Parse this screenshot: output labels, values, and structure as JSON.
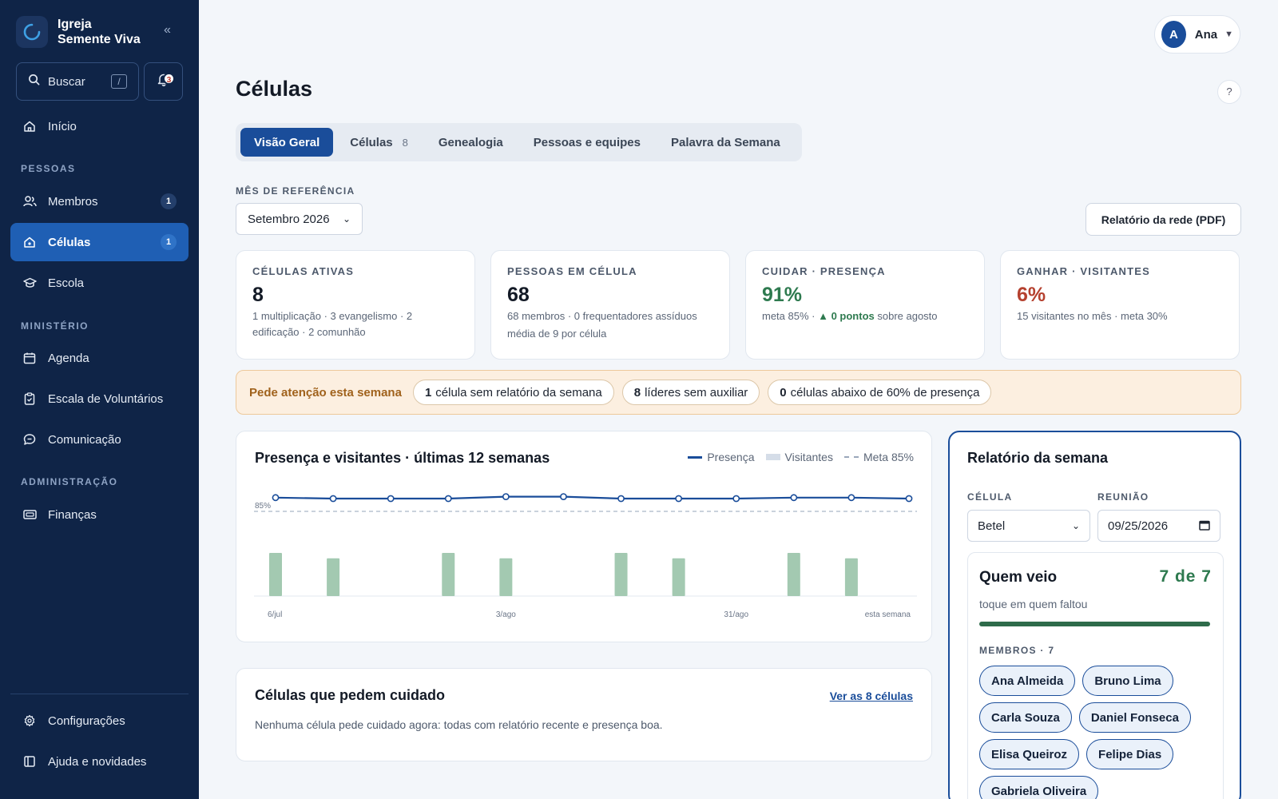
{
  "brand": {
    "line1": "Igreja",
    "line2": "Semente Viva"
  },
  "sidebar": {
    "search_label": "Buscar",
    "search_shortcut": "/",
    "notifications_count": "3",
    "home": "Início",
    "sections": {
      "people": "PESSOAS",
      "ministry": "MINISTÉRIO",
      "admin": "ADMINISTRAÇÃO"
    },
    "items": {
      "members": {
        "label": "Membros",
        "count": "1"
      },
      "cells": {
        "label": "Células",
        "count": "1"
      },
      "school": {
        "label": "Escola"
      },
      "agenda": {
        "label": "Agenda"
      },
      "volunteers": {
        "label": "Escala de Voluntários"
      },
      "communication": {
        "label": "Comunicação"
      },
      "finances": {
        "label": "Finanças"
      },
      "settings": {
        "label": "Configurações"
      },
      "help": {
        "label": "Ajuda e novidades"
      }
    }
  },
  "user": {
    "initial": "A",
    "name": "Ana"
  },
  "page": {
    "title": "Células",
    "help": "?",
    "tabs": [
      {
        "label": "Visão Geral"
      },
      {
        "label": "Células",
        "count": "8"
      },
      {
        "label": "Genealogia"
      },
      {
        "label": "Pessoas e equipes"
      },
      {
        "label": "Palavra da Semana"
      }
    ],
    "ref_label": "MÊS DE REFERÊNCIA",
    "ref_value": "Setembro 2026",
    "report_button": "Relatório da rede (PDF)"
  },
  "kpis": [
    {
      "label": "CÉLULAS ATIVAS",
      "value": "8",
      "sub": "1 multiplicação · 3 evangelismo · 2 edificação · 2 comunhão"
    },
    {
      "label": "PESSOAS EM CÉLULA",
      "value": "68",
      "sub": "68 membros · 0 frequentadores assíduos",
      "sub2": "média de 9 por célula"
    },
    {
      "label": "CUIDAR · PRESENÇA",
      "value": "91%",
      "sub_a": "meta 85% · ",
      "sub_b": "▲ 0 pontos",
      "sub_c": " sobre agosto"
    },
    {
      "label": "GANHAR · VISITANTES",
      "value": "6%",
      "sub": "15 visitantes no mês · meta 30%"
    }
  ],
  "alert": {
    "title": "Pede atenção esta semana",
    "chips": [
      {
        "num": "1",
        "text": "célula sem relatório da semana"
      },
      {
        "num": "8",
        "text": "líderes sem auxiliar"
      },
      {
        "num": "0",
        "text": "células abaixo de 60% de presença"
      }
    ]
  },
  "chart_card": {
    "title": "Presença e visitantes · últimas 12 semanas",
    "legend": {
      "presence": "Presença",
      "visitors": "Visitantes",
      "goal": "Meta 85%"
    }
  },
  "chart_data": {
    "type": "line",
    "title": "Presença e visitantes · últimas 12 semanas",
    "x_tick_labels": [
      "6/jul",
      "3/ago",
      "31/ago",
      "esta semana"
    ],
    "goal_label": "85%",
    "goal": 85,
    "ylim": [
      0,
      100
    ],
    "series": [
      {
        "name": "Presença",
        "type": "line",
        "values": [
          91,
          90,
          90,
          90,
          92,
          92,
          90,
          90,
          90,
          91,
          91,
          90
        ]
      },
      {
        "name": "Visitantes",
        "type": "bar",
        "values": [
          8,
          7,
          0,
          8,
          7,
          0,
          8,
          7,
          0,
          8,
          7,
          0
        ]
      }
    ],
    "colors": {
      "presence": "#1a4d9a",
      "visitors": "#a3c9b1",
      "goal": "#aab6c6"
    }
  },
  "care_card": {
    "title": "Células que pedem cuidado",
    "link": "Ver as 8 células",
    "text": "Nenhuma célula pede cuidado agora: todas com relatório recente e presença boa."
  },
  "week_report": {
    "title": "Relatório da semana",
    "cell_label": "CÉLULA",
    "cell_value": "Betel",
    "meeting_label": "REUNIÃO",
    "meeting_value": "09/25/2026",
    "who_title": "Quem veio",
    "who_count": "7 de 7",
    "who_fraction": 1.0,
    "who_sub": "toque em quem faltou",
    "members_label": "MEMBROS · 7",
    "members": [
      "Ana Almeida",
      "Bruno Lima",
      "Carla Souza",
      "Daniel Fonseca",
      "Elisa Queiroz",
      "Felipe Dias",
      "Gabriela Oliveira"
    ]
  }
}
